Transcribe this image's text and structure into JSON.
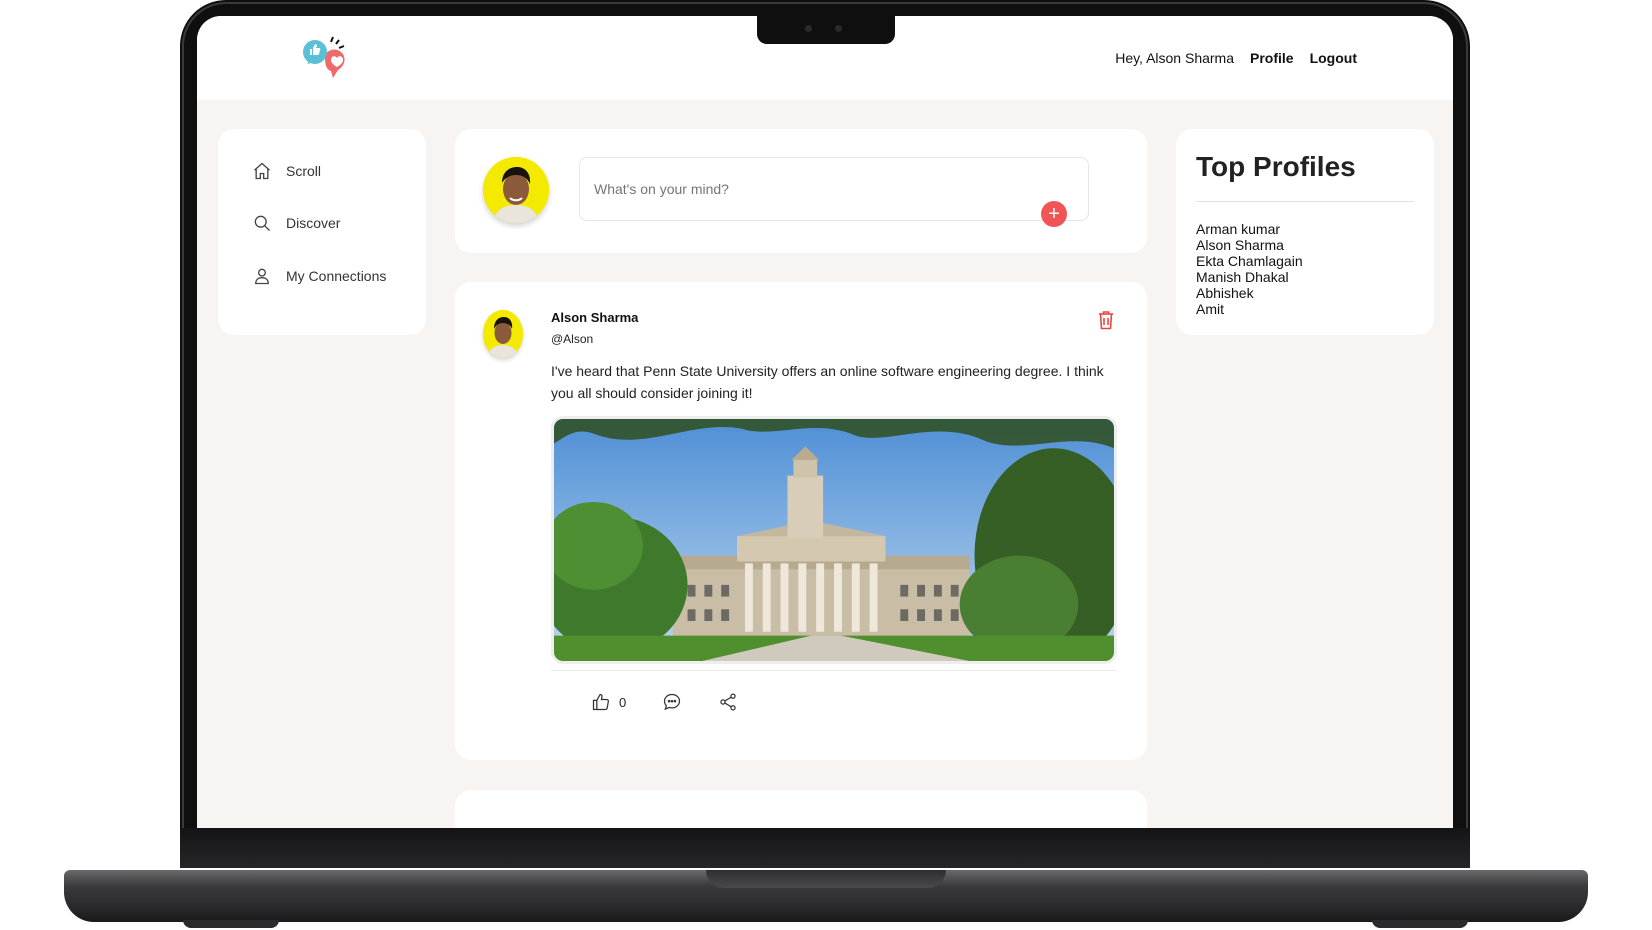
{
  "header": {
    "greeting": "Hey, Alson Sharma",
    "profile_label": "Profile",
    "logout_label": "Logout",
    "logo_icon": "chat-like-heart-logo"
  },
  "sidebar": {
    "items": [
      {
        "label": "Scroll",
        "icon": "home-icon"
      },
      {
        "label": "Discover",
        "icon": "search-icon"
      },
      {
        "label": "My Connections",
        "icon": "user-icon"
      }
    ]
  },
  "composer": {
    "placeholder": "What's on your mind?",
    "add_icon": "plus-icon"
  },
  "post": {
    "author": "Alson Sharma",
    "handle": "@Alson",
    "text": "I've heard that Penn State University offers an online software engineering degree. I think you all should consider joining it!",
    "like_count": "0",
    "delete_icon": "trash-icon"
  },
  "top_profiles": {
    "title": "Top Profiles",
    "names": [
      "Arman kumar",
      "Alson Sharma",
      "Ekta Chamlagain",
      "Manish Dhakal",
      "Abhishek",
      "Amit"
    ]
  },
  "colors": {
    "accent": "#f05454",
    "background": "#f7f4f1",
    "avatar_bg": "#f3ea00"
  }
}
